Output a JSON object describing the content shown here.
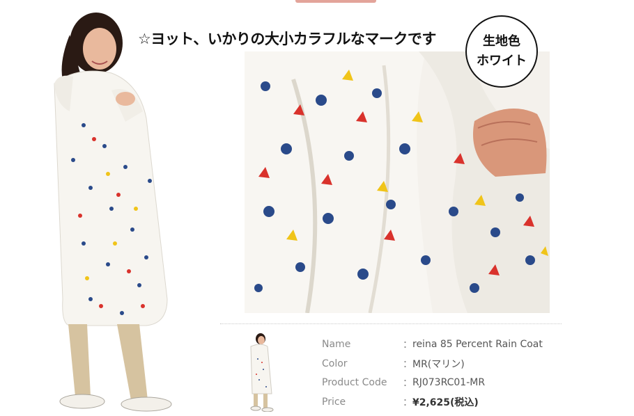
{
  "headline": "☆ヨット、いかりの大小カラフルなマークです",
  "badge": {
    "line1": "生地色",
    "line2": "ホワイト"
  },
  "product": {
    "rows": [
      {
        "label": "Name",
        "colon": "：",
        "value": "reina 85 Percent Rain Coat"
      },
      {
        "label": "Color",
        "colon": "：",
        "value": "MR(マリン)"
      },
      {
        "label": "Product Code",
        "colon": "：",
        "value": "RJ073RC01-MR"
      },
      {
        "label": "Price",
        "colon": "：",
        "value": "¥2,625(税込)"
      }
    ]
  },
  "colors": {
    "navy": "#2a4a8a",
    "red": "#d9322c",
    "yellow": "#f0c419",
    "skin": "#e8b49a",
    "khaki": "#d6c3a0"
  }
}
